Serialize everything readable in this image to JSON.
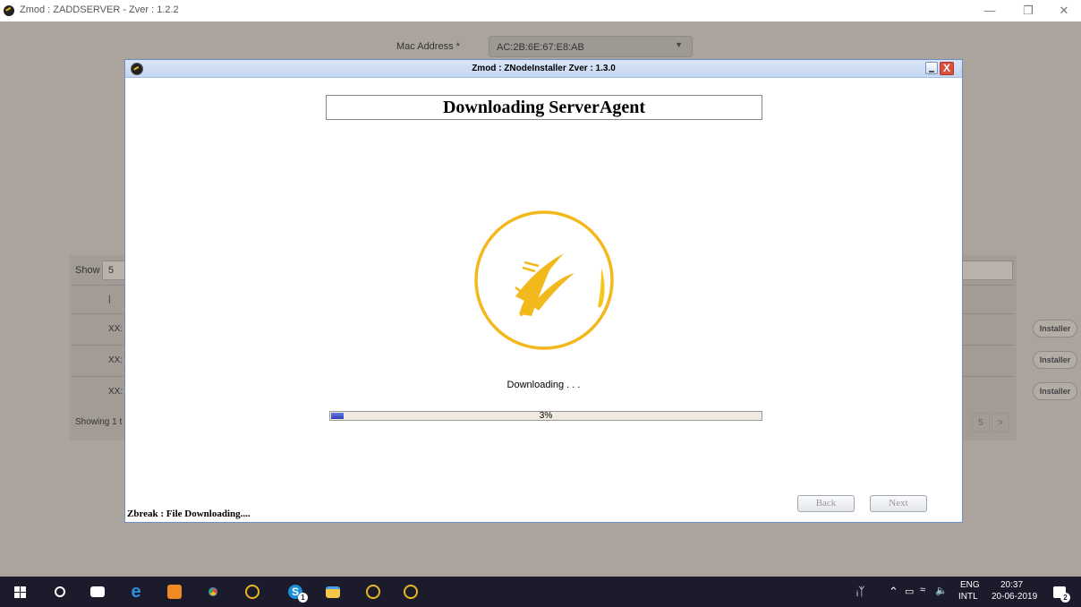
{
  "window": {
    "title": "Zmod : ZADDSERVER - Zver : 1.2.2"
  },
  "background": {
    "mac_label": "Mac Address *",
    "mac_value": "AC:2B:6E:67:E8:AB",
    "show_label": "Show",
    "show_value": "5",
    "rows": [
      {
        "id": "XX:",
        "action": "Installer"
      },
      {
        "id": "XX:",
        "action": "Installer"
      },
      {
        "id": "XX:",
        "action": "Installer"
      }
    ],
    "footer": "Showing 1 t",
    "pages": [
      "5",
      ">"
    ]
  },
  "dialog": {
    "title": "Zmod : ZNodeInstaller Zver : 1.3.0",
    "heading": "Downloading ServerAgent",
    "status": "Downloading . . .",
    "progress": {
      "value": 3,
      "label": "3%"
    },
    "buttons": {
      "back": "Back",
      "next": "Next"
    },
    "footer_status": "Zbreak : File Downloading....",
    "close_glyph": "X"
  },
  "taskbar": {
    "lang_top": "ENG",
    "lang_bottom": "INTL",
    "time": "20:37",
    "date": "20-06-2019",
    "skype_badge": "1",
    "notification_badge": "2",
    "icons": [
      "windows-icon",
      "search-icon",
      "mail-icon",
      "edge-icon",
      "sublime-icon",
      "chrome-icon",
      "zmod-icon",
      "skype-icon",
      "folder-icon",
      "zmod-icon",
      "zmod-icon"
    ],
    "colors": {
      "accent": "#f2b81c",
      "progress": "#2b3ab8",
      "taskbar": "#1b1b2b"
    }
  }
}
